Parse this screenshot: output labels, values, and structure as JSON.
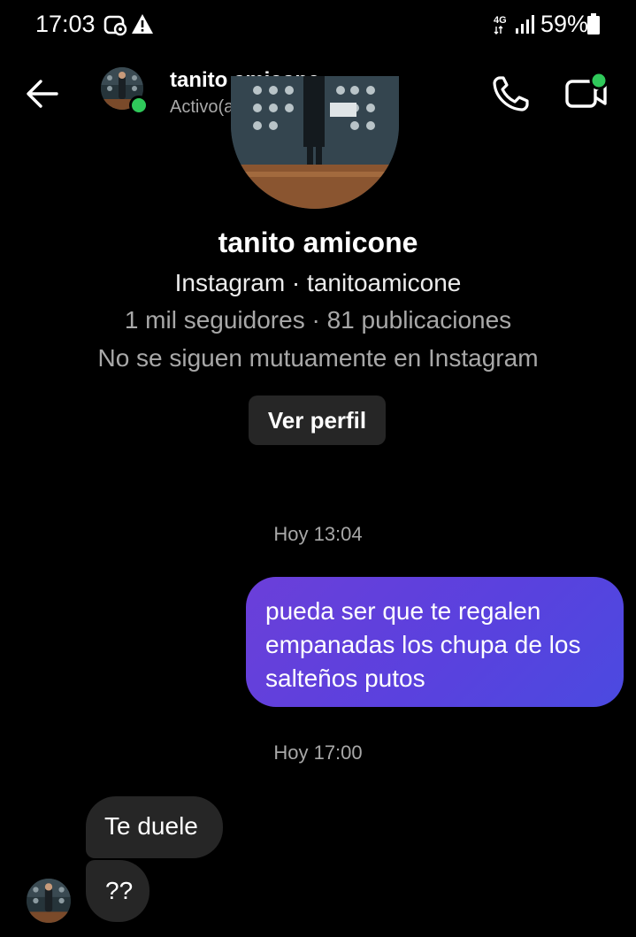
{
  "status_bar": {
    "time": "17:03",
    "battery": "59%",
    "network": "4G",
    "icons": [
      "screen-record-icon",
      "warning-icon",
      "network-4g-icon",
      "signal-icon",
      "battery-icon"
    ]
  },
  "header": {
    "name": "tanito amicone",
    "status": "Activo(a) ahora",
    "online_color": "#2fc95a"
  },
  "profile": {
    "name": "tanito amicone",
    "handle_line": "Instagram · tanitoamicone",
    "stats_line": "1 mil seguidores · 81 publicaciones",
    "follow_line": "No se siguen mutuamente en Instagram",
    "view_profile_label": "Ver perfil"
  },
  "messages": {
    "timestamp_1": "Hoy 13:04",
    "sent_1_lines": [
      "pueda ser que te regalen",
      "empanadas los chupa de los",
      "salteños putos"
    ],
    "timestamp_2": "Hoy 17:00",
    "received_1": "Te duele",
    "received_2": "??"
  },
  "colors": {
    "background": "#000000",
    "sent_bubble_start": "#6b3fd9",
    "sent_bubble_end": "#4b4ae0",
    "received_bubble": "#262626",
    "secondary_text": "#a8a8a8"
  }
}
